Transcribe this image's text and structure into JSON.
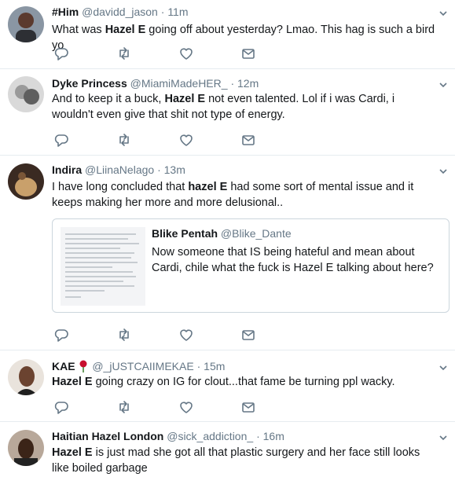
{
  "tweets": [
    {
      "name": "#Him",
      "handle": "@davidd_jason",
      "time": "11m",
      "text": [
        {
          "t": "What was ",
          "b": false
        },
        {
          "t": "Hazel E",
          "b": true
        },
        {
          "t": " going off about yesterday? Lmao. This hag is such a bird yo",
          "b": false
        }
      ]
    },
    {
      "name": "Dyke Princess",
      "handle": "@MiamiMadeHER_",
      "time": "12m",
      "text": [
        {
          "t": "And to keep it a buck, ",
          "b": false
        },
        {
          "t": "Hazel E",
          "b": true
        },
        {
          "t": " not even talented. Lol if i was Cardi, i wouldn't even give that shit not type of energy.",
          "b": false
        }
      ]
    },
    {
      "name": "Indira",
      "handle": "@LiinaNelago",
      "time": "13m",
      "text": [
        {
          "t": "I have long concluded that ",
          "b": false
        },
        {
          "t": "hazel E",
          "b": true
        },
        {
          "t": " had some sort of mental issue and it keeps making her more and more delusional..",
          "b": false
        }
      ],
      "quote": {
        "name": "Blike Pentah",
        "handle": "@Blike_Dante",
        "text": "Now someone that IS being hateful and mean about Cardi, chile what the fuck is Hazel E talking about here?"
      }
    },
    {
      "name": "KAE",
      "handle": "@_jUSTCAIIMEKAE",
      "time": "15m",
      "text": [
        {
          "t": "Hazel E",
          "b": true
        },
        {
          "t": " going crazy on IG for clout...that fame be turning ppl wacky.",
          "b": false
        }
      ]
    },
    {
      "name": "Haitian Hazel London",
      "handle": "@sick_addiction_",
      "time": "16m",
      "text": [
        {
          "t": "Hazel E",
          "b": true
        },
        {
          "t": " is just mad she got all that plastic surgery and her face still looks like boiled garbage",
          "b": false
        }
      ]
    }
  ],
  "separator": "·",
  "icons": [
    "reply-icon",
    "retweet-icon",
    "like-icon",
    "message-icon",
    "chevron-down-icon",
    "rose-emoji-icon"
  ],
  "colors": {
    "text": "#14171a",
    "secondary": "#657786",
    "border": "#e6ecf0",
    "icon": "#657786"
  }
}
